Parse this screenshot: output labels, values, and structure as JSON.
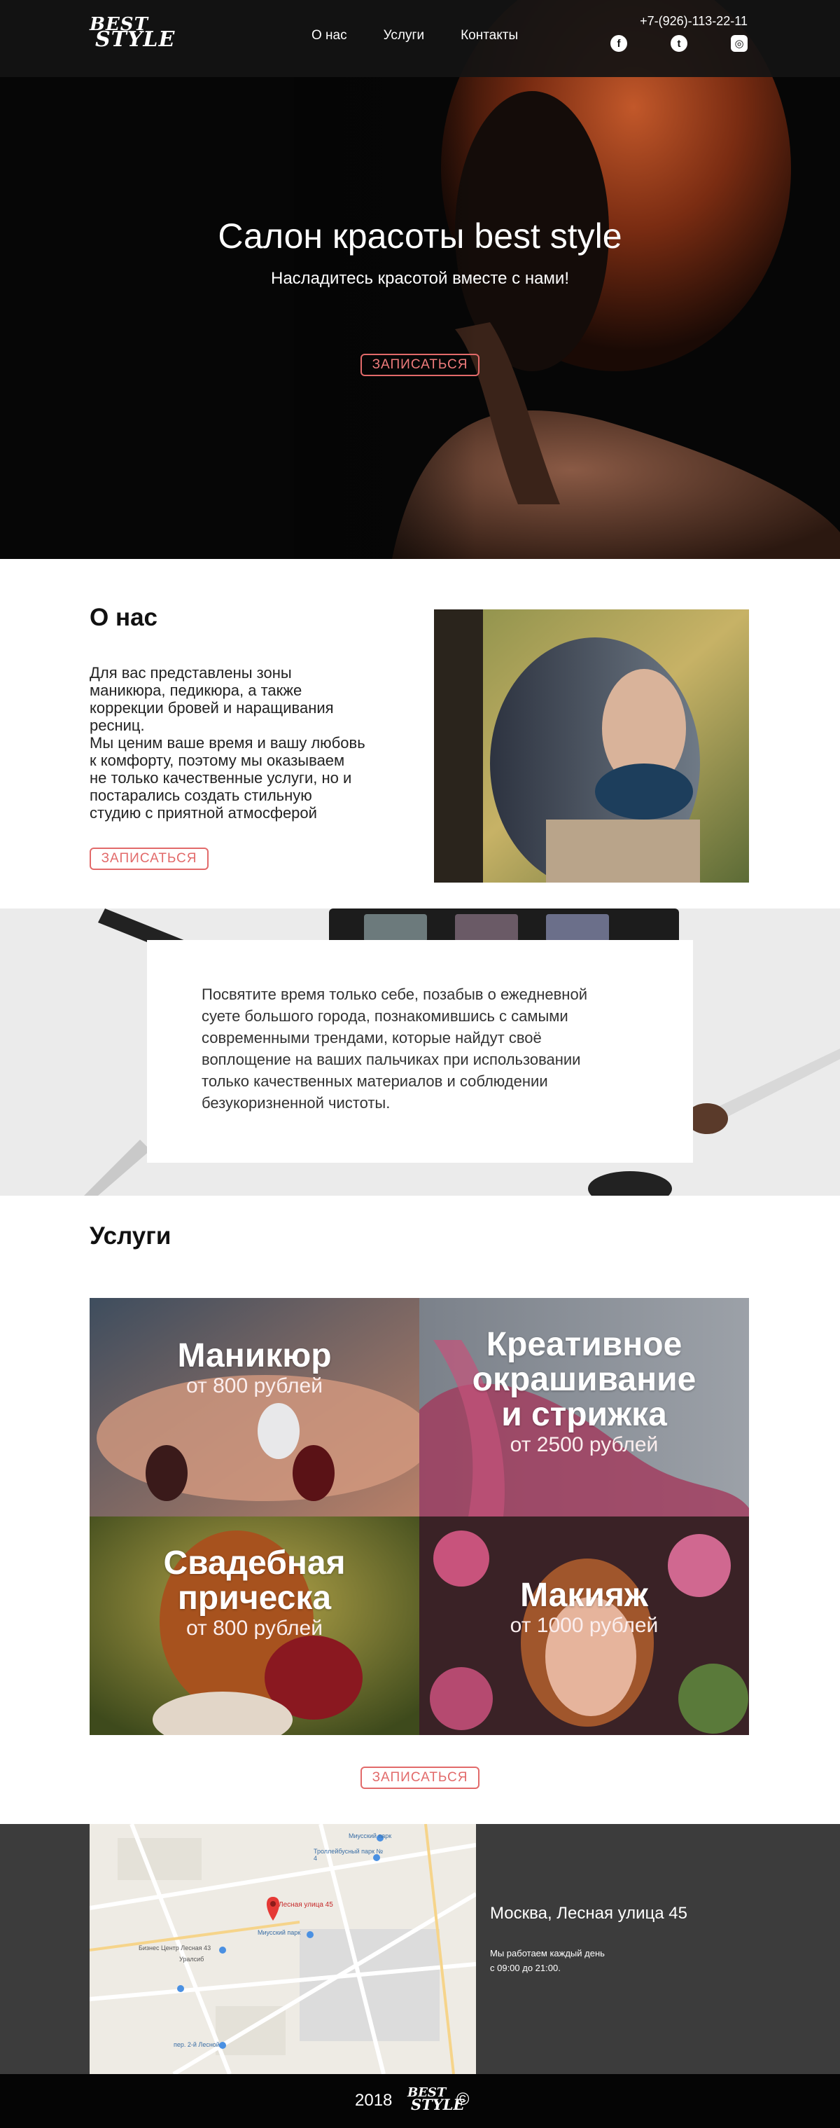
{
  "brand": {
    "logo_line1": "BEST",
    "logo_line2": "STYLE"
  },
  "nav": {
    "about": "О нас",
    "services": "Услуги",
    "contacts": "Контакты"
  },
  "phone": "+7-(926)-113-22-11",
  "socials": [
    {
      "icon": "facebook-icon",
      "glyph": "f"
    },
    {
      "icon": "tumblr-icon",
      "glyph": "t"
    },
    {
      "icon": "instagram-icon",
      "glyph": "◎"
    }
  ],
  "hero": {
    "title": "Салон красоты best style",
    "subtitle": "Насладитесь красотой вместе с нами!",
    "button": "ЗАПИСАТЬСЯ"
  },
  "about": {
    "title": "О нас",
    "text": "Для вас представлены зоны\nманикюра, педикюра, а также\nкоррекции бровей и наращивания\nресниц.\nМы ценим ваше время и вашу любовь\nк комфорту, поэтому мы оказываем\nне только качественные услуги, но и\nпостарались создать стильную\nстудию с приятной атмосферой",
    "button": "ЗАПИСАТЬСЯ"
  },
  "quote": {
    "text": "Посвятите время только себе, позабыв о ежедневной\nсуете большого города, познакомившись с самыми\nсовременными трендами, которые найдут своё\nвоплощение на ваших пальчиках при использовании\n только качественных материалов и соблюдении\nбезукоризненной чистоты."
  },
  "services": {
    "title": "Услуги",
    "items": [
      {
        "name": "Маникюр",
        "price": "от 800 рублей"
      },
      {
        "name": "Креативное\nокрашивание\nи стрижка",
        "price": "от 2500 рублей"
      },
      {
        "name": "Свадебная\nприческа",
        "price": "от 800 рублей"
      },
      {
        "name": "Макияж",
        "price": "от 1000 рублей"
      }
    ],
    "button": "ЗАПИСАТЬСЯ"
  },
  "contact": {
    "address": "Москва, Лесная улица 45",
    "hours_line1": "Мы работаем каждый день",
    "hours_line2": "с 09:00 до 21:00.",
    "map_labels": {
      "pin": "Лесная улица 45",
      "park1": "Миусский парк",
      "park2": "Троллейбусный парк № 4",
      "park3": "Миусский парк",
      "business": "Бизнес Центр Лесная 43",
      "bank": "Уралсиб",
      "lane": "пер. 2-й Лесной"
    }
  },
  "footer": {
    "year": "2018",
    "logo_line1": "BEST",
    "logo_line2": "STYLE",
    "copyright": "©"
  },
  "colors": {
    "accent": "#e26a6a",
    "header_bg": "#141414",
    "contact_bg": "#3c3c3c",
    "footer_bg": "#050505"
  }
}
